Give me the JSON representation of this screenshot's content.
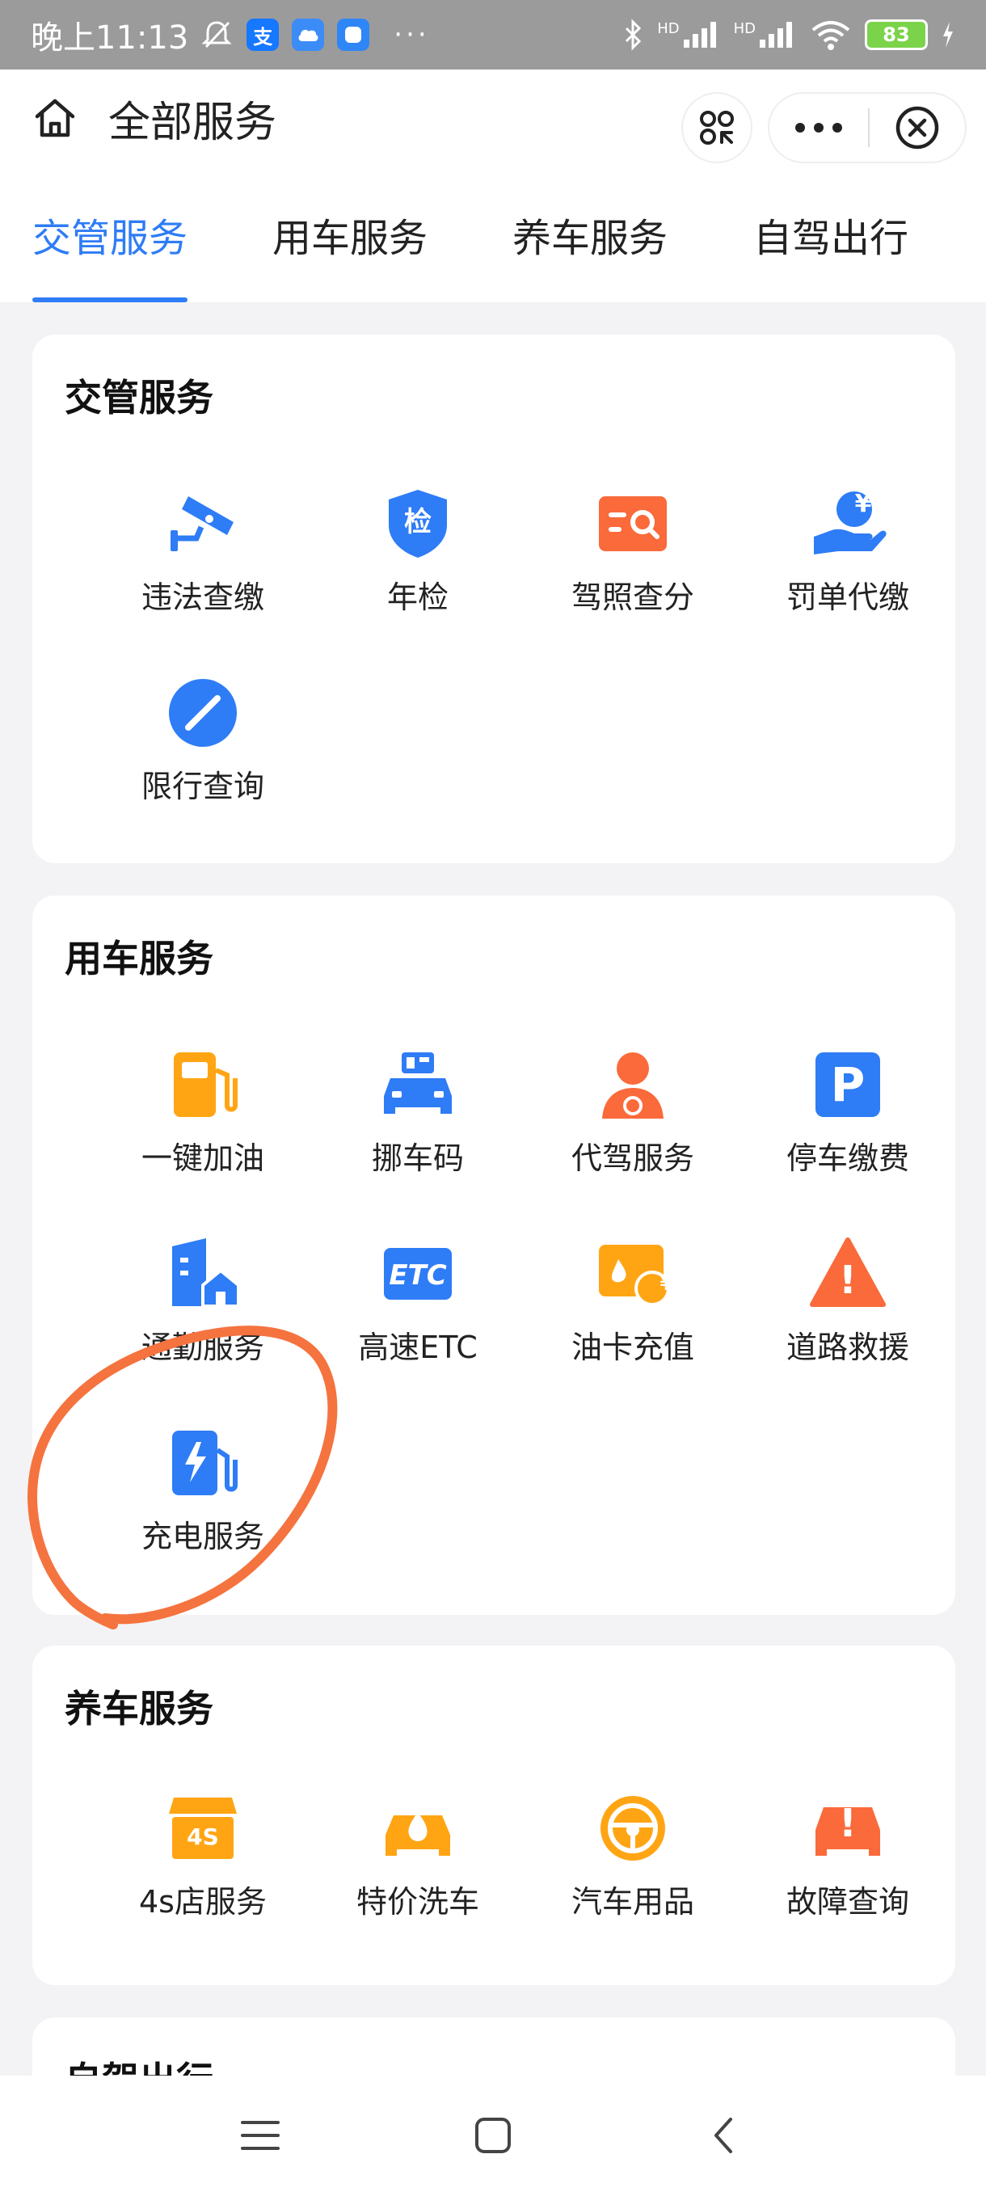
{
  "status_bar": {
    "time": "晚上11:13",
    "app_icons": [
      "支",
      "",
      ""
    ],
    "more": "···",
    "hd1": "HD",
    "hd2": "HD",
    "battery": "83",
    "colors": {
      "alipay": "#1677ff",
      "cloud": "#3b8cf7",
      "app3": "#2f86f6"
    }
  },
  "header": {
    "title": "全部服务"
  },
  "tabs": [
    {
      "label": "交管服务",
      "active": true
    },
    {
      "label": "用车服务"
    },
    {
      "label": "养车服务"
    },
    {
      "label": "自驾出行"
    }
  ],
  "sections": [
    {
      "title": "交管服务",
      "items": [
        {
          "label": "违法查缴",
          "icon": "camera-icon"
        },
        {
          "label": "年检",
          "icon": "inspection-shield-icon",
          "glyph": "检"
        },
        {
          "label": "驾照查分",
          "icon": "license-search-icon"
        },
        {
          "label": "罚单代缴",
          "icon": "hand-yuan-icon",
          "glyph": "¥"
        },
        {
          "label": "限行查询",
          "icon": "no-entry-icon"
        }
      ]
    },
    {
      "title": "用车服务",
      "items": [
        {
          "label": "一键加油",
          "icon": "fuel-pump-icon"
        },
        {
          "label": "挪车码",
          "icon": "car-code-icon"
        },
        {
          "label": "代驾服务",
          "icon": "driver-icon"
        },
        {
          "label": "停车缴费",
          "icon": "parking-icon",
          "glyph": "P"
        },
        {
          "label": "通勤服务",
          "icon": "commute-building-icon"
        },
        {
          "label": "高速ETC",
          "icon": "etc-icon",
          "glyph": "ETC"
        },
        {
          "label": "油卡充值",
          "icon": "fuel-card-icon",
          "glyph": "¥"
        },
        {
          "label": "道路救援",
          "icon": "warning-triangle-icon",
          "glyph": "!"
        },
        {
          "label": "充电服务",
          "icon": "charging-station-icon"
        }
      ]
    },
    {
      "title": "养车服务",
      "items": [
        {
          "label": "4s店服务",
          "icon": "4s-store-icon",
          "glyph": "4S"
        },
        {
          "label": "特价洗车",
          "icon": "car-wash-icon"
        },
        {
          "label": "汽车用品",
          "icon": "steering-wheel-icon"
        },
        {
          "label": "故障查询",
          "icon": "car-fault-icon",
          "glyph": "!"
        }
      ]
    },
    {
      "title": "自驾出行"
    }
  ],
  "colors": {
    "accent": "#2e7cf6",
    "orange": "#fa6a3a",
    "yellow": "#ffa514",
    "annotation": "#f5733f"
  }
}
